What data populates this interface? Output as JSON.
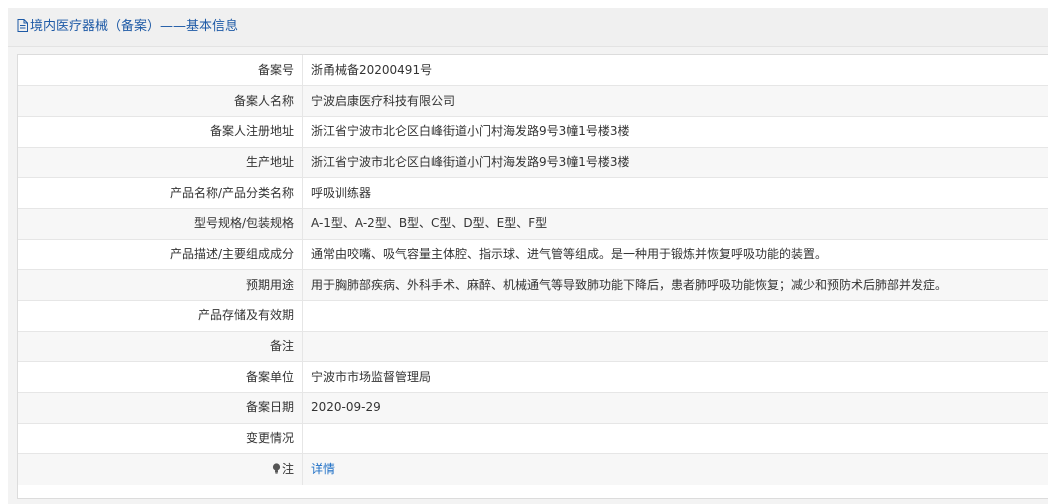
{
  "header": {
    "title": "境内医疗器械（备案）——基本信息",
    "icon": "document-icon"
  },
  "rows": [
    {
      "label": "备案号",
      "value": "浙甬械备20200491号"
    },
    {
      "label": "备案人名称",
      "value": "宁波启康医疗科技有限公司"
    },
    {
      "label": "备案人注册地址",
      "value": "浙江省宁波市北仑区白峰街道小门村海发路9号3幢1号楼3楼"
    },
    {
      "label": "生产地址",
      "value": "浙江省宁波市北仑区白峰街道小门村海发路9号3幢1号楼3楼"
    },
    {
      "label": "产品名称/产品分类名称",
      "value": "呼吸训练器"
    },
    {
      "label": "型号规格/包装规格",
      "value": "A-1型、A-2型、B型、C型、D型、E型、F型"
    },
    {
      "label": "产品描述/主要组成成分",
      "value": "通常由咬嘴、吸气容量主体腔、指示球、进气管等组成。是一种用于锻炼并恢复呼吸功能的装置。"
    },
    {
      "label": "预期用途",
      "value": "用于胸肺部疾病、外科手术、麻醉、机械通气等导致肺功能下降后，患者肺呼吸功能恢复；减少和预防术后肺部并发症。"
    },
    {
      "label": "产品存储及有效期",
      "value": ""
    },
    {
      "label": "备注",
      "value": ""
    },
    {
      "label": "备案单位",
      "value": "宁波市市场监督管理局"
    },
    {
      "label": "备案日期",
      "value": "2020-09-29"
    },
    {
      "label": "变更情况",
      "value": ""
    }
  ],
  "note": {
    "label": "注",
    "icon": "lightbulb-icon",
    "link_text": "详情"
  },
  "colors": {
    "title": "#1e5aa6",
    "link": "#1e6fc6",
    "header_bg": "#f0f0f0",
    "stripe_bg": "#f7f7f7",
    "border": "#e6e6e6"
  }
}
